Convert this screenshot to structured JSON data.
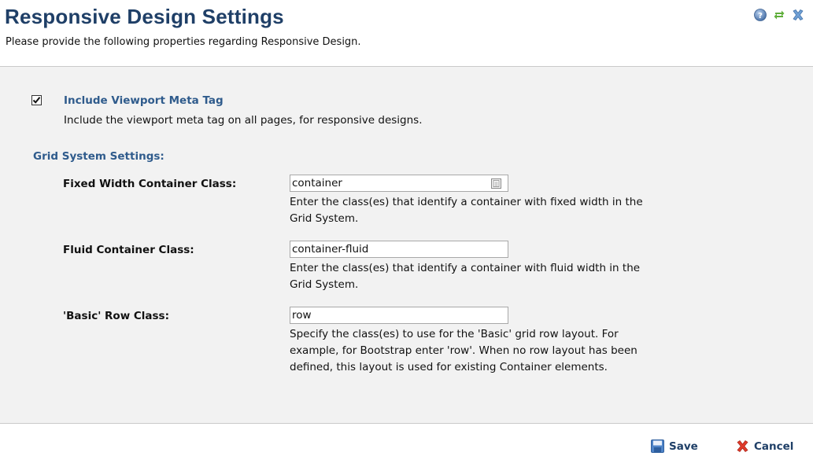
{
  "header": {
    "title": "Responsive Design Settings",
    "subtitle": "Please provide the following properties regarding Responsive Design.",
    "icons": [
      "help-icon",
      "refresh-icon",
      "close-icon"
    ]
  },
  "viewport_option": {
    "checked": true,
    "label": "Include Viewport Meta Tag",
    "description": "Include the viewport meta tag on all pages, for responsive designs."
  },
  "grid_section": {
    "title": "Grid System Settings:",
    "fields": [
      {
        "label": "Fixed Width Container Class:",
        "value": "container",
        "help_line1": "Enter the class(es) that identify a container with fixed width in the",
        "help_line2": "Grid System."
      },
      {
        "label": "Fluid Container Class:",
        "value": "container-fluid",
        "help_line1": "Enter the class(es) that identify a container with fluid width in the",
        "help_line2": "Grid System."
      },
      {
        "label": "'Basic' Row Class:",
        "value": "row",
        "help_line1": "Specify the class(es) to use for the 'Basic' grid row layout. For",
        "help_line2": "example, for Bootstrap enter 'row'. When no row layout has been",
        "help_line3": "defined, this layout is used for existing Container elements."
      }
    ]
  },
  "footer": {
    "save_label": "Save",
    "cancel_label": "Cancel"
  },
  "colors": {
    "title": "#1f3f67",
    "accent": "#2f5b8c",
    "panel_bg": "#f2f2f2"
  }
}
